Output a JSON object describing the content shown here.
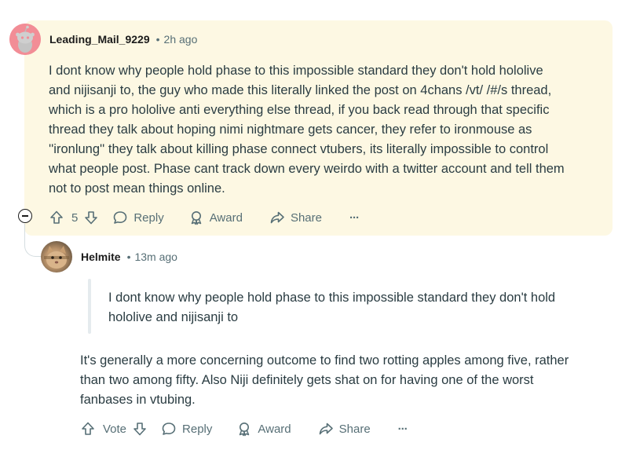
{
  "parent_comment": {
    "username": "Leading_Mail_9229",
    "timestamp": "2h ago",
    "body_lines": [
      "I dont know why people hold phase to this impossible standard they don't hold hololive",
      "and nijisanji to, the guy who made this literally linked the post on 4chans /vt/ /#/s thread,",
      "which is a pro hololive anti everything else thread, if you back read through that specific",
      "thread they talk about hoping nimi nightmare gets cancer, they refer to ironmouse as",
      "''ironlung'' they talk about killing phase connect vtubers, its literally impossible to control",
      "what people post. Phase cant track down every weirdo with a twitter account and tell them",
      "not to post mean things online."
    ],
    "vote_count": "5",
    "actions": {
      "reply": "Reply",
      "award": "Award",
      "share": "Share",
      "more": "···"
    },
    "collapse_symbol": "−"
  },
  "reply_comment": {
    "username": "Helmite",
    "timestamp": "13m ago",
    "quote_lines": [
      "I dont know why people hold phase to this impossible standard they don't hold",
      "hololive and nijisanji to"
    ],
    "body_lines": [
      "It's generally a more concerning outcome to find two rotting apples among five, rather",
      "than two among fifty. Also Niji definitely gets shat on for having one of the worst",
      "fanbases in vtubing."
    ],
    "vote_label": "Vote",
    "actions": {
      "reply": "Reply",
      "award": "Award",
      "share": "Share",
      "more": "···"
    }
  },
  "colors": {
    "highlight_bg": "#fdf8e3",
    "avatar_pink": "#f28d96",
    "meta_gray": "#576f76",
    "text": "#2a3c42"
  },
  "separator": "•"
}
